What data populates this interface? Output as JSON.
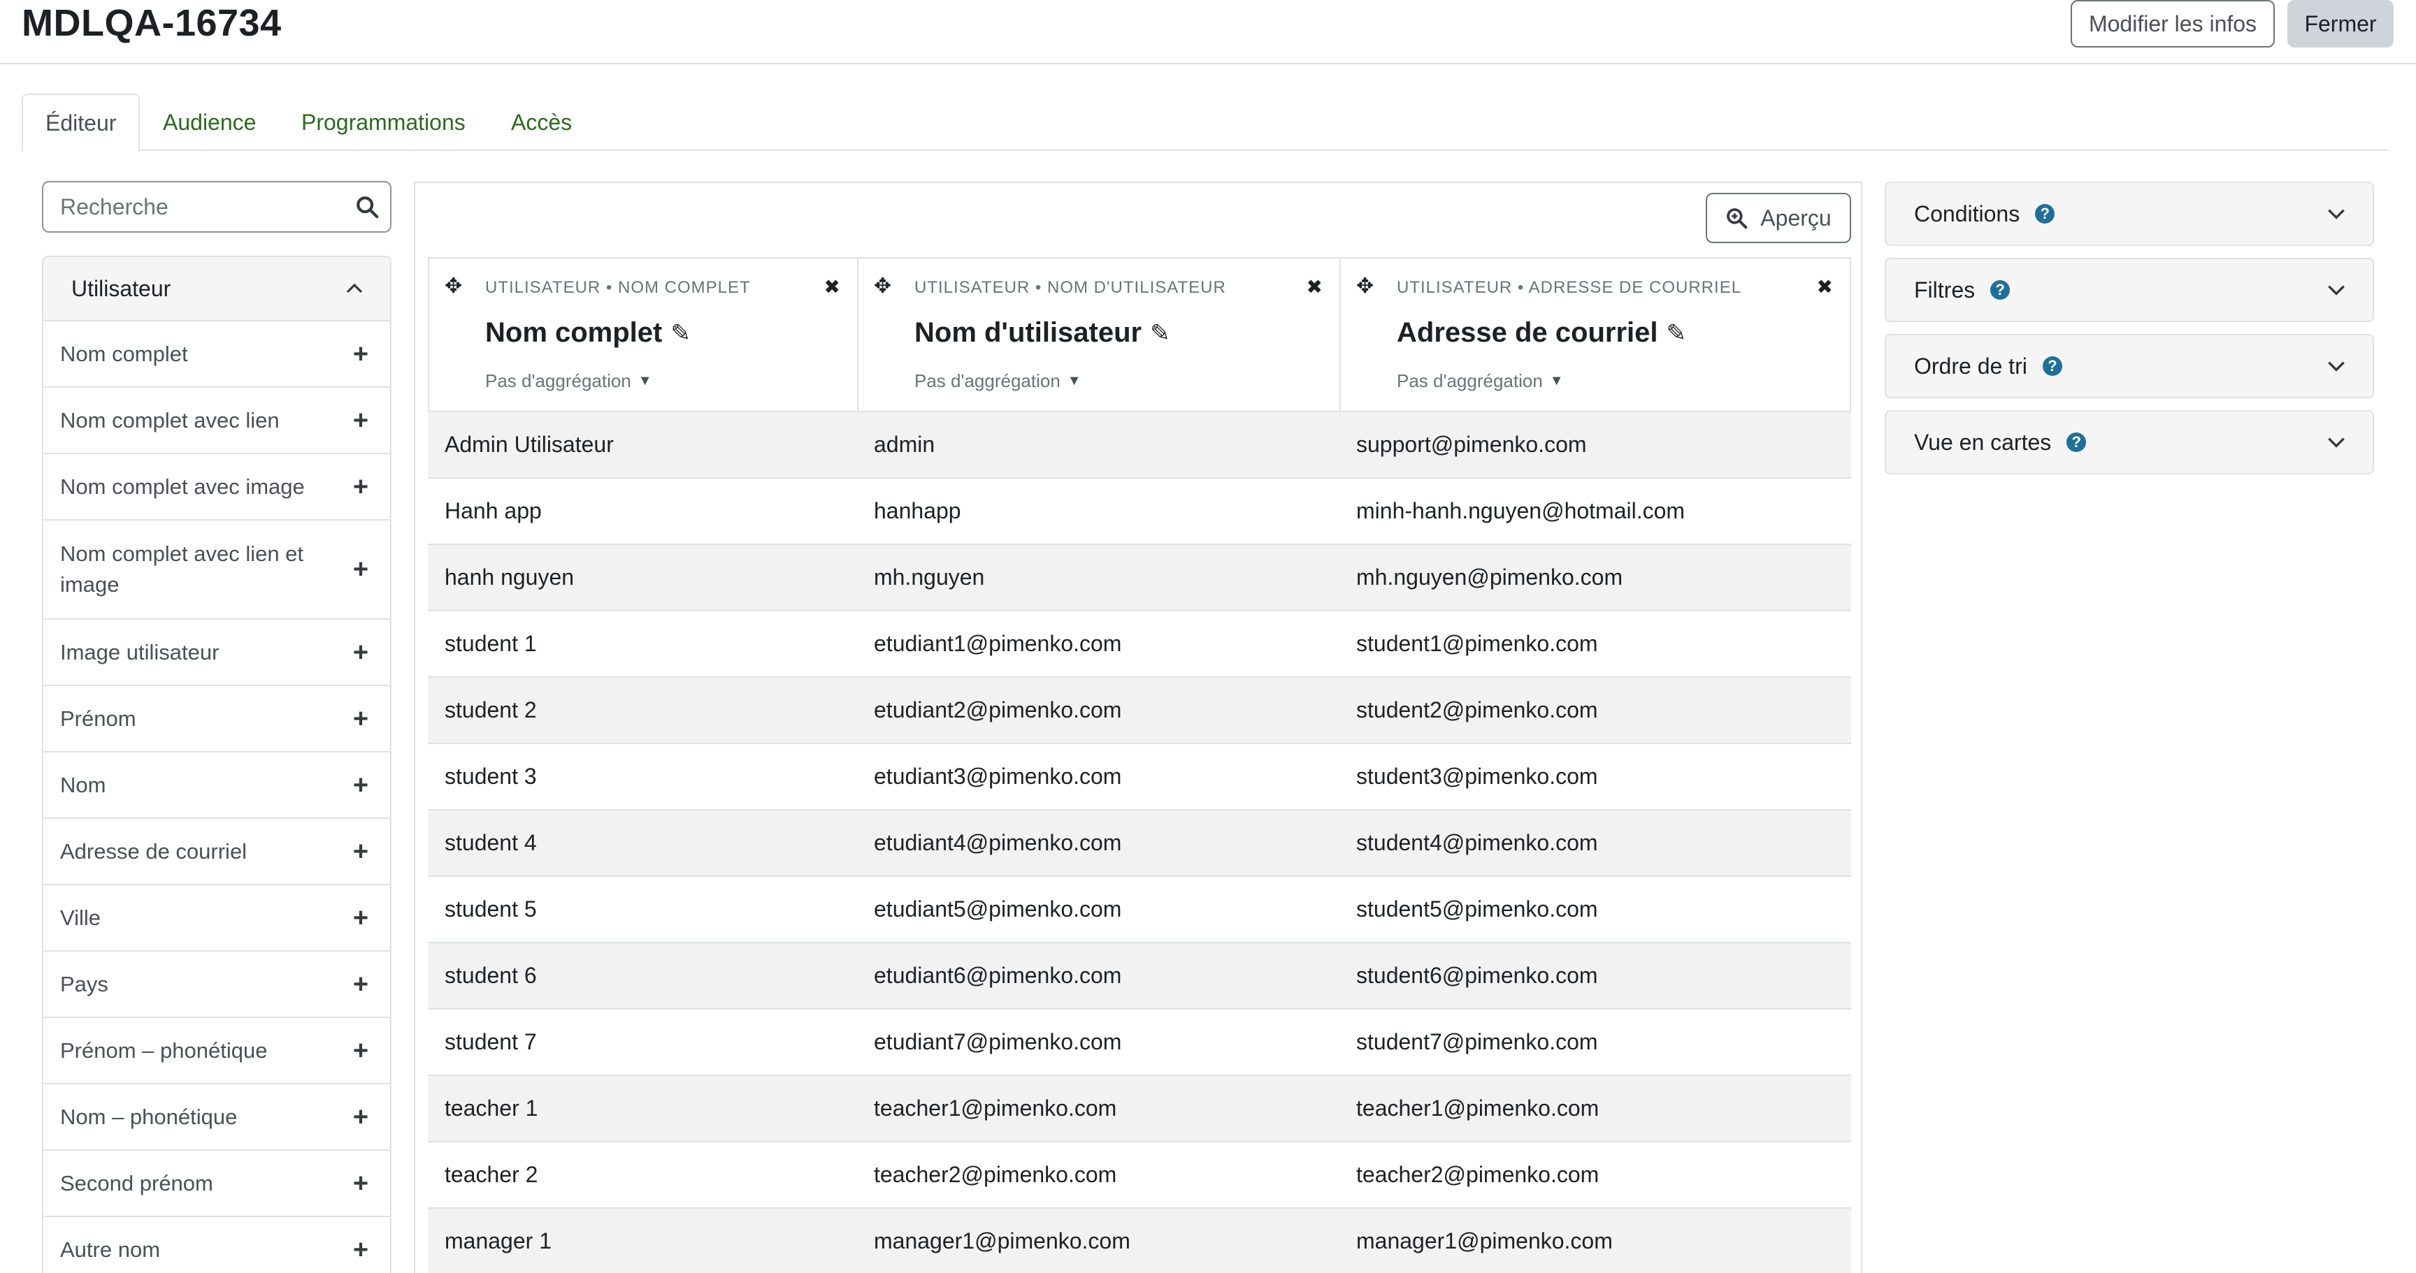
{
  "header": {
    "title": "MDLQA-16734",
    "edit_label": "Modifier les infos",
    "close_label": "Fermer"
  },
  "tabs": [
    {
      "label": "Éditeur"
    },
    {
      "label": "Audience"
    },
    {
      "label": "Programmations"
    },
    {
      "label": "Accès"
    }
  ],
  "search": {
    "placeholder": "Recherche"
  },
  "sidebar": {
    "heading": "Utilisateur",
    "items": [
      {
        "label": "Nom complet"
      },
      {
        "label": "Nom complet avec lien"
      },
      {
        "label": "Nom complet avec image"
      },
      {
        "label": "Nom complet avec lien et image"
      },
      {
        "label": "Image utilisateur"
      },
      {
        "label": "Prénom"
      },
      {
        "label": "Nom"
      },
      {
        "label": "Adresse de courriel"
      },
      {
        "label": "Ville"
      },
      {
        "label": "Pays"
      },
      {
        "label": "Prénom – phonétique"
      },
      {
        "label": "Nom – phonétique"
      },
      {
        "label": "Second prénom"
      },
      {
        "label": "Autre nom"
      }
    ]
  },
  "preview": {
    "label": "Aperçu"
  },
  "columns": [
    {
      "category": "UTILISATEUR • NOM COMPLET",
      "name": "Nom complet",
      "aggregation": "Pas d'aggrégation"
    },
    {
      "category": "UTILISATEUR • NOM D'UTILISATEUR",
      "name": "Nom d'utilisateur",
      "aggregation": "Pas d'aggrégation"
    },
    {
      "category": "UTILISATEUR • ADRESSE DE COURRIEL",
      "name": "Adresse de courriel",
      "aggregation": "Pas d'aggrégation"
    }
  ],
  "rows": [
    [
      "Admin Utilisateur",
      "admin",
      "support@pimenko.com"
    ],
    [
      "Hanh app",
      "hanhapp",
      "minh-hanh.nguyen@hotmail.com"
    ],
    [
      "hanh nguyen",
      "mh.nguyen",
      "mh.nguyen@pimenko.com"
    ],
    [
      "student 1",
      "etudiant1@pimenko.com",
      "student1@pimenko.com"
    ],
    [
      "student 2",
      "etudiant2@pimenko.com",
      "student2@pimenko.com"
    ],
    [
      "student 3",
      "etudiant3@pimenko.com",
      "student3@pimenko.com"
    ],
    [
      "student 4",
      "etudiant4@pimenko.com",
      "student4@pimenko.com"
    ],
    [
      "student 5",
      "etudiant5@pimenko.com",
      "student5@pimenko.com"
    ],
    [
      "student 6",
      "etudiant6@pimenko.com",
      "student6@pimenko.com"
    ],
    [
      "student 7",
      "etudiant7@pimenko.com",
      "student7@pimenko.com"
    ],
    [
      "teacher 1",
      "teacher1@pimenko.com",
      "teacher1@pimenko.com"
    ],
    [
      "teacher 2",
      "teacher2@pimenko.com",
      "teacher2@pimenko.com"
    ],
    [
      "manager 1",
      "manager1@pimenko.com",
      "manager1@pimenko.com"
    ]
  ],
  "panels": [
    {
      "label": "Conditions"
    },
    {
      "label": "Filtres"
    },
    {
      "label": "Ordre de tri"
    },
    {
      "label": "Vue en cartes"
    }
  ]
}
